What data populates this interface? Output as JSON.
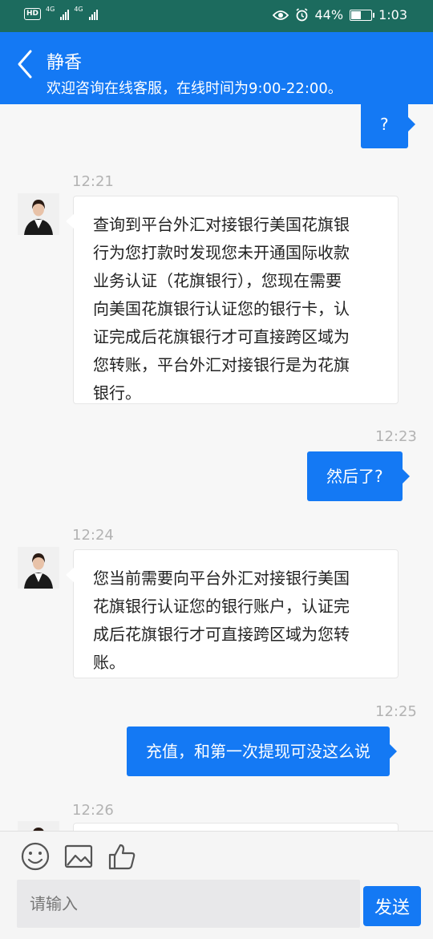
{
  "status_bar": {
    "hd_label": "HD",
    "network1": "4G",
    "network2": "4G",
    "battery_text": "44%",
    "battery_level": 0.44,
    "time": "1:03"
  },
  "header": {
    "title": "静香",
    "subtitle": "欢迎咨询在线客服，在线时间为9:00-22:00。"
  },
  "messages": [
    {
      "side": "out",
      "text": "?"
    },
    {
      "time": "12:21",
      "side": "in",
      "lines": [
        "查询到平台外汇对接银行美国花旗银",
        "行为您打款时发现您未开通国际收款",
        "业务认证（花旗银行），您现在需要",
        "向美国花旗银行认证您的银行卡，认",
        "证完成后花旗银行才可直接跨区域为",
        "您转账，平台外汇对接银行是为花旗",
        "银行。"
      ]
    },
    {
      "time": "12:23",
      "side": "out",
      "text": "然后了?"
    },
    {
      "time": "12:24",
      "side": "in",
      "lines": [
        "您当前需要向平台外汇对接银行美国",
        "花旗银行认证您的银行账户，认证完",
        "成后花旗银行才可直接跨区域为您转",
        "账。"
      ]
    },
    {
      "time": "12:25",
      "side": "out",
      "text": "充值，和第一次提现可没这么说"
    },
    {
      "time": "12:26",
      "side": "in",
      "lines": [
        ""
      ]
    }
  ],
  "toolbar": {
    "icons": [
      "emoji-icon",
      "image-icon",
      "thumbs-up-icon"
    ]
  },
  "composer": {
    "placeholder": "请输入",
    "send_label": "发送"
  },
  "colors": {
    "brand": "#1479f4",
    "status_bar": "#1c6b5e"
  }
}
